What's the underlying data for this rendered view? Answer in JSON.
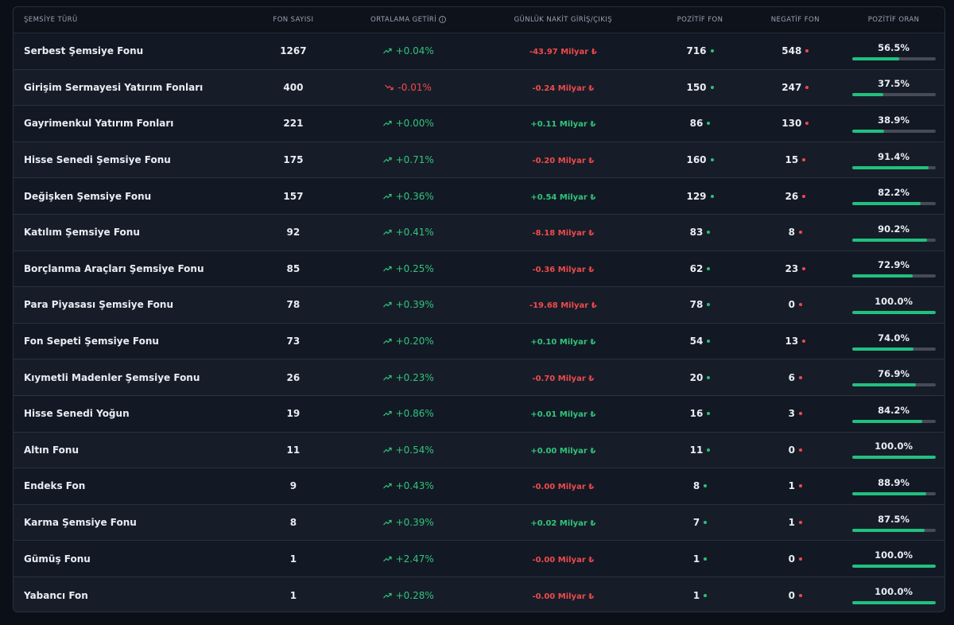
{
  "header": {
    "name": "ŞEMSİYE TÜRÜ",
    "count": "FON SAYISI",
    "avg": "ORTALAMA GETİRİ",
    "flow": "GÜNLÜK NAKİT GİRİŞ/ÇIKIŞ",
    "pos": "POZİTİF FON",
    "neg": "NEGATİF FON",
    "ratio": "POZİTİF ORAN"
  },
  "colors": {
    "positive": "#32c47a",
    "negative": "#f04a4a",
    "bar": "#22c07f"
  },
  "rows": [
    {
      "name": "Serbest Şemsiye Fonu",
      "count": "1267",
      "avg": "+0.04%",
      "avg_dir": "up",
      "flow": "-43.97 Milyar ₺",
      "flow_dir": "down",
      "pos": "716",
      "neg": "548",
      "ratio": "56.5%",
      "ratio_value": 56.5
    },
    {
      "name": "Girişim Sermayesi Yatırım Fonları",
      "count": "400",
      "avg": "-0.01%",
      "avg_dir": "down",
      "flow": "-0.24 Milyar ₺",
      "flow_dir": "down",
      "pos": "150",
      "neg": "247",
      "ratio": "37.5%",
      "ratio_value": 37.5
    },
    {
      "name": "Gayrimenkul Yatırım Fonları",
      "count": "221",
      "avg": "+0.00%",
      "avg_dir": "up",
      "flow": "+0.11 Milyar ₺",
      "flow_dir": "up",
      "pos": "86",
      "neg": "130",
      "ratio": "38.9%",
      "ratio_value": 38.9
    },
    {
      "name": "Hisse Senedi Şemsiye Fonu",
      "count": "175",
      "avg": "+0.71%",
      "avg_dir": "up",
      "flow": "-0.20 Milyar ₺",
      "flow_dir": "down",
      "pos": "160",
      "neg": "15",
      "ratio": "91.4%",
      "ratio_value": 91.4
    },
    {
      "name": "Değişken Şemsiye Fonu",
      "count": "157",
      "avg": "+0.36%",
      "avg_dir": "up",
      "flow": "+0.54 Milyar ₺",
      "flow_dir": "up",
      "pos": "129",
      "neg": "26",
      "ratio": "82.2%",
      "ratio_value": 82.2
    },
    {
      "name": "Katılım Şemsiye Fonu",
      "count": "92",
      "avg": "+0.41%",
      "avg_dir": "up",
      "flow": "-8.18 Milyar ₺",
      "flow_dir": "down",
      "pos": "83",
      "neg": "8",
      "ratio": "90.2%",
      "ratio_value": 90.2
    },
    {
      "name": "Borçlanma Araçları Şemsiye Fonu",
      "count": "85",
      "avg": "+0.25%",
      "avg_dir": "up",
      "flow": "-0.36 Milyar ₺",
      "flow_dir": "down",
      "pos": "62",
      "neg": "23",
      "ratio": "72.9%",
      "ratio_value": 72.9
    },
    {
      "name": "Para Piyasası Şemsiye Fonu",
      "count": "78",
      "avg": "+0.39%",
      "avg_dir": "up",
      "flow": "-19.68 Milyar ₺",
      "flow_dir": "down",
      "pos": "78",
      "neg": "0",
      "ratio": "100.0%",
      "ratio_value": 100.0
    },
    {
      "name": "Fon Sepeti Şemsiye Fonu",
      "count": "73",
      "avg": "+0.20%",
      "avg_dir": "up",
      "flow": "+0.10 Milyar ₺",
      "flow_dir": "up",
      "pos": "54",
      "neg": "13",
      "ratio": "74.0%",
      "ratio_value": 74.0
    },
    {
      "name": "Kıymetli Madenler Şemsiye Fonu",
      "count": "26",
      "avg": "+0.23%",
      "avg_dir": "up",
      "flow": "-0.70 Milyar ₺",
      "flow_dir": "down",
      "pos": "20",
      "neg": "6",
      "ratio": "76.9%",
      "ratio_value": 76.9
    },
    {
      "name": "Hisse Senedi Yoğun",
      "count": "19",
      "avg": "+0.86%",
      "avg_dir": "up",
      "flow": "+0.01 Milyar ₺",
      "flow_dir": "up",
      "pos": "16",
      "neg": "3",
      "ratio": "84.2%",
      "ratio_value": 84.2
    },
    {
      "name": "Altın Fonu",
      "count": "11",
      "avg": "+0.54%",
      "avg_dir": "up",
      "flow": "+0.00 Milyar ₺",
      "flow_dir": "up",
      "pos": "11",
      "neg": "0",
      "ratio": "100.0%",
      "ratio_value": 100.0
    },
    {
      "name": "Endeks Fon",
      "count": "9",
      "avg": "+0.43%",
      "avg_dir": "up",
      "flow": "-0.00 Milyar ₺",
      "flow_dir": "down",
      "pos": "8",
      "neg": "1",
      "ratio": "88.9%",
      "ratio_value": 88.9
    },
    {
      "name": "Karma Şemsiye Fonu",
      "count": "8",
      "avg": "+0.39%",
      "avg_dir": "up",
      "flow": "+0.02 Milyar ₺",
      "flow_dir": "up",
      "pos": "7",
      "neg": "1",
      "ratio": "87.5%",
      "ratio_value": 87.5
    },
    {
      "name": "Gümüş Fonu",
      "count": "1",
      "avg": "+2.47%",
      "avg_dir": "up",
      "flow": "-0.00 Milyar ₺",
      "flow_dir": "down",
      "pos": "1",
      "neg": "0",
      "ratio": "100.0%",
      "ratio_value": 100.0
    },
    {
      "name": "Yabancı Fon",
      "count": "1",
      "avg": "+0.28%",
      "avg_dir": "up",
      "flow": "-0.00 Milyar ₺",
      "flow_dir": "down",
      "pos": "1",
      "neg": "0",
      "ratio": "100.0%",
      "ratio_value": 100.0
    }
  ]
}
